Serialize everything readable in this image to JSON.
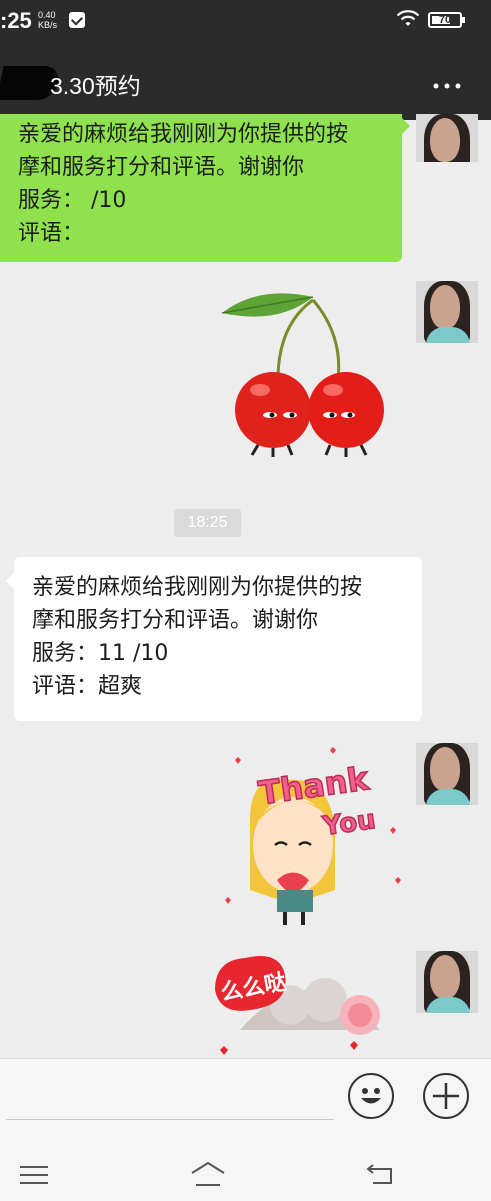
{
  "status_bar": {
    "time": ":25",
    "net_speed_value": "0.40",
    "net_speed_unit": "KB/s",
    "battery_level": "70",
    "icons": [
      "message-notification-icon",
      "wifi-icon",
      "battery-icon"
    ]
  },
  "header": {
    "title": "3.30预约",
    "more_label": "...",
    "icons": [
      "back-icon",
      "more-icon"
    ]
  },
  "messages": [
    {
      "sender": "self",
      "type": "text",
      "bubble_color": "#8fe24e",
      "lines": [
        "亲爱的麻烦给我刚刚为你提供的按",
        "摩和服务打分和评语。谢谢你",
        "服务：  /10",
        "评语："
      ]
    },
    {
      "sender": "self",
      "type": "sticker",
      "sticker": "cherry-sticker"
    },
    {
      "type": "timestamp",
      "text": "18:25"
    },
    {
      "sender": "other",
      "type": "text",
      "bubble_color": "#ffffff",
      "lines": [
        "亲爱的麻烦给我刚刚为你提供的按",
        "摩和服务打分和评语。谢谢你",
        "服务：11 /10",
        "评语：超爽"
      ]
    },
    {
      "sender": "self",
      "type": "sticker",
      "sticker": "thank-you-sticker",
      "text_line1": "Thank",
      "text_line2": "You"
    },
    {
      "sender": "self",
      "type": "sticker",
      "sticker": "kiss-sticker",
      "text": "么么哒"
    }
  ],
  "input_bar": {
    "icons": [
      "emoji-icon",
      "plus-icon"
    ]
  },
  "nav_bar": {
    "icons": [
      "menu-icon",
      "home-icon",
      "back-nav-icon"
    ]
  },
  "colors": {
    "header_bg": "#2b2b2b",
    "chat_bg": "#ededed",
    "self_bubble": "#8fe24e",
    "other_bubble": "#ffffff"
  }
}
